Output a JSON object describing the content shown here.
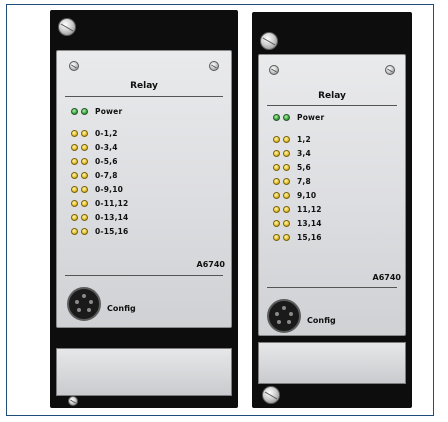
{
  "modules": [
    {
      "title": "Relay",
      "power_label": "Power",
      "channels": [
        "0-1,2",
        "0-3,4",
        "0-5,6",
        "0-7,8",
        "0-9,10",
        "0-11,12",
        "0-13,14",
        "0-15,16"
      ],
      "model": "A6740",
      "config_label": "Config"
    },
    {
      "title": "Relay",
      "power_label": "Power",
      "channels": [
        "1,2",
        "3,4",
        "5,6",
        "7,8",
        "9,10",
        "11,12",
        "13,14",
        "15,16"
      ],
      "model": "A6740",
      "config_label": "Config"
    }
  ],
  "colors": {
    "power_led": "#3fae44",
    "channel_led": "#e8c531",
    "module_body": "#0d0d0d",
    "frame_border": "#1f4e7a"
  }
}
